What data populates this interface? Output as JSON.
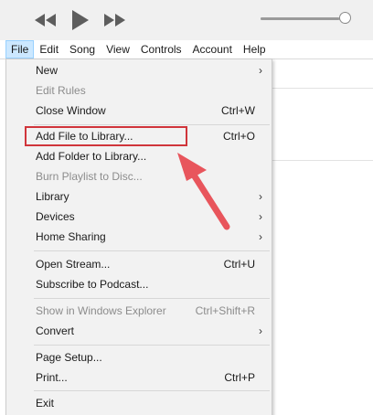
{
  "player": {
    "prev_icon": "rewind-icon",
    "play_icon": "play-icon",
    "next_icon": "fast-forward-icon",
    "volume_level": 0.93
  },
  "menubar": {
    "items": [
      {
        "label": "File",
        "active": true
      },
      {
        "label": "Edit"
      },
      {
        "label": "Song"
      },
      {
        "label": "View"
      },
      {
        "label": "Controls"
      },
      {
        "label": "Account"
      },
      {
        "label": "Help"
      }
    ]
  },
  "file_menu": {
    "items": [
      {
        "label": "New",
        "shortcut": "",
        "submenu": true,
        "disabled": false
      },
      {
        "label": "Edit Rules",
        "shortcut": "",
        "submenu": false,
        "disabled": true
      },
      {
        "label": "Close Window",
        "shortcut": "Ctrl+W",
        "submenu": false,
        "disabled": false
      },
      {
        "label": "Add File to Library...",
        "shortcut": "Ctrl+O",
        "submenu": false,
        "disabled": false
      },
      {
        "label": "Add Folder to Library...",
        "shortcut": "",
        "submenu": false,
        "disabled": false
      },
      {
        "label": "Burn Playlist to Disc...",
        "shortcut": "",
        "submenu": false,
        "disabled": true
      },
      {
        "label": "Library",
        "shortcut": "",
        "submenu": true,
        "disabled": false
      },
      {
        "label": "Devices",
        "shortcut": "",
        "submenu": true,
        "disabled": false
      },
      {
        "label": "Home Sharing",
        "shortcut": "",
        "submenu": true,
        "disabled": false
      },
      {
        "label": "Open Stream...",
        "shortcut": "Ctrl+U",
        "submenu": false,
        "disabled": false
      },
      {
        "label": "Subscribe to Podcast...",
        "shortcut": "",
        "submenu": false,
        "disabled": false
      },
      {
        "label": "Show in Windows Explorer",
        "shortcut": "Ctrl+Shift+R",
        "submenu": false,
        "disabled": true
      },
      {
        "label": "Convert",
        "shortcut": "",
        "submenu": true,
        "disabled": false
      },
      {
        "label": "Page Setup...",
        "shortcut": "",
        "submenu": false,
        "disabled": false
      },
      {
        "label": "Print...",
        "shortcut": "Ctrl+P",
        "submenu": false,
        "disabled": false
      },
      {
        "label": "Exit",
        "shortcut": "",
        "submenu": false,
        "disabled": false
      }
    ],
    "submenu_glyph": "›"
  },
  "annotation": {
    "highlight_color": "#d0353b",
    "arrow_color": "#e8555c"
  },
  "colors": {
    "menu_bg": "#f2f2f2",
    "menubar_active_bg": "#cce8ff",
    "disabled_text": "#8c8c8c",
    "player_bg": "#f0f0f0"
  }
}
